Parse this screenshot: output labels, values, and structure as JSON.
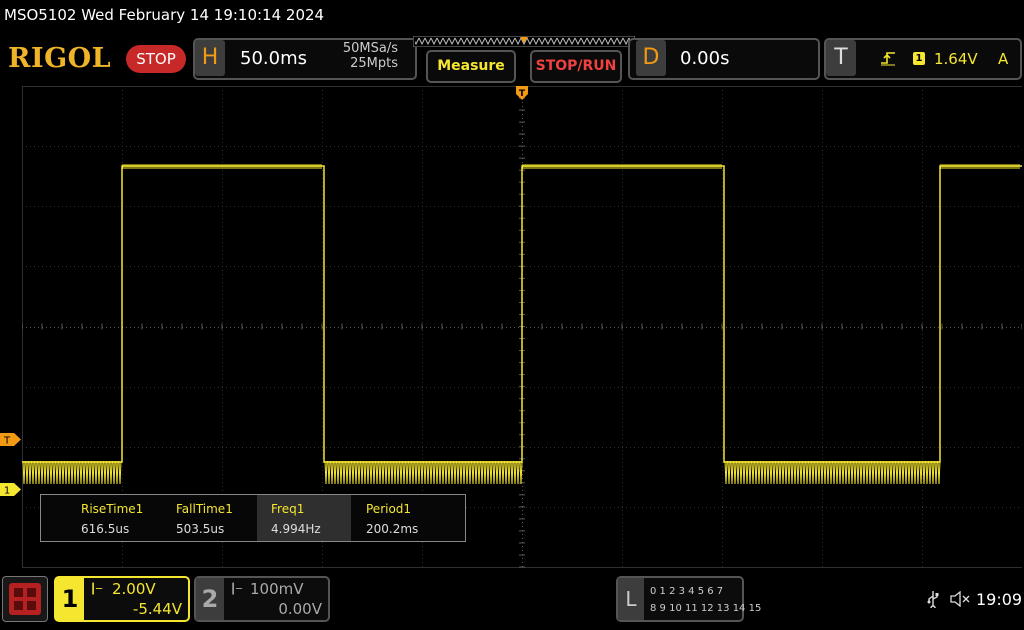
{
  "titlebar": {
    "text": "MSO5102  Wed February 14 19:10:14 2024"
  },
  "brand": {
    "logo": "RIGOL",
    "status": "STOP"
  },
  "horizontal": {
    "letter": "H",
    "timebase": "50.0ms",
    "sample_rate": "50MSa/s",
    "memory_depth": "25Mpts"
  },
  "buttons": {
    "measure": "Measure",
    "stop_run": "STOP/RUN"
  },
  "delay": {
    "letter": "D",
    "value": "0.00s"
  },
  "trigger": {
    "letter": "T",
    "edge_icon": "rising-edge-icon",
    "source": "1",
    "level": "1.64V",
    "mode": "A"
  },
  "markers": {
    "trigger": "T",
    "channel1": "1"
  },
  "measurements": [
    {
      "label": "RiseTime1",
      "value": "616.5us"
    },
    {
      "label": "FallTime1",
      "value": "503.5us"
    },
    {
      "label": "Freq1",
      "value": "4.994Hz"
    },
    {
      "label": "Period1",
      "value": "200.2ms"
    }
  ],
  "channel1": {
    "number": "1",
    "scale": "2.00V",
    "offset": "-5.44V",
    "color": "#f5e630"
  },
  "channel2": {
    "number": "2",
    "scale": "100mV",
    "offset": "0.00V",
    "color": "#aaaaaa"
  },
  "logic_analyzer": {
    "letter": "L",
    "row1": "0 1 2 3  4 5 6 7",
    "row2": "8  9 10 11 12 13 14 15"
  },
  "status_bar": {
    "clock": "19:09"
  },
  "colors": {
    "accent_orange": "#f29a14",
    "trace_yellow": "#f5e630",
    "stop_red": "#c72828"
  }
}
